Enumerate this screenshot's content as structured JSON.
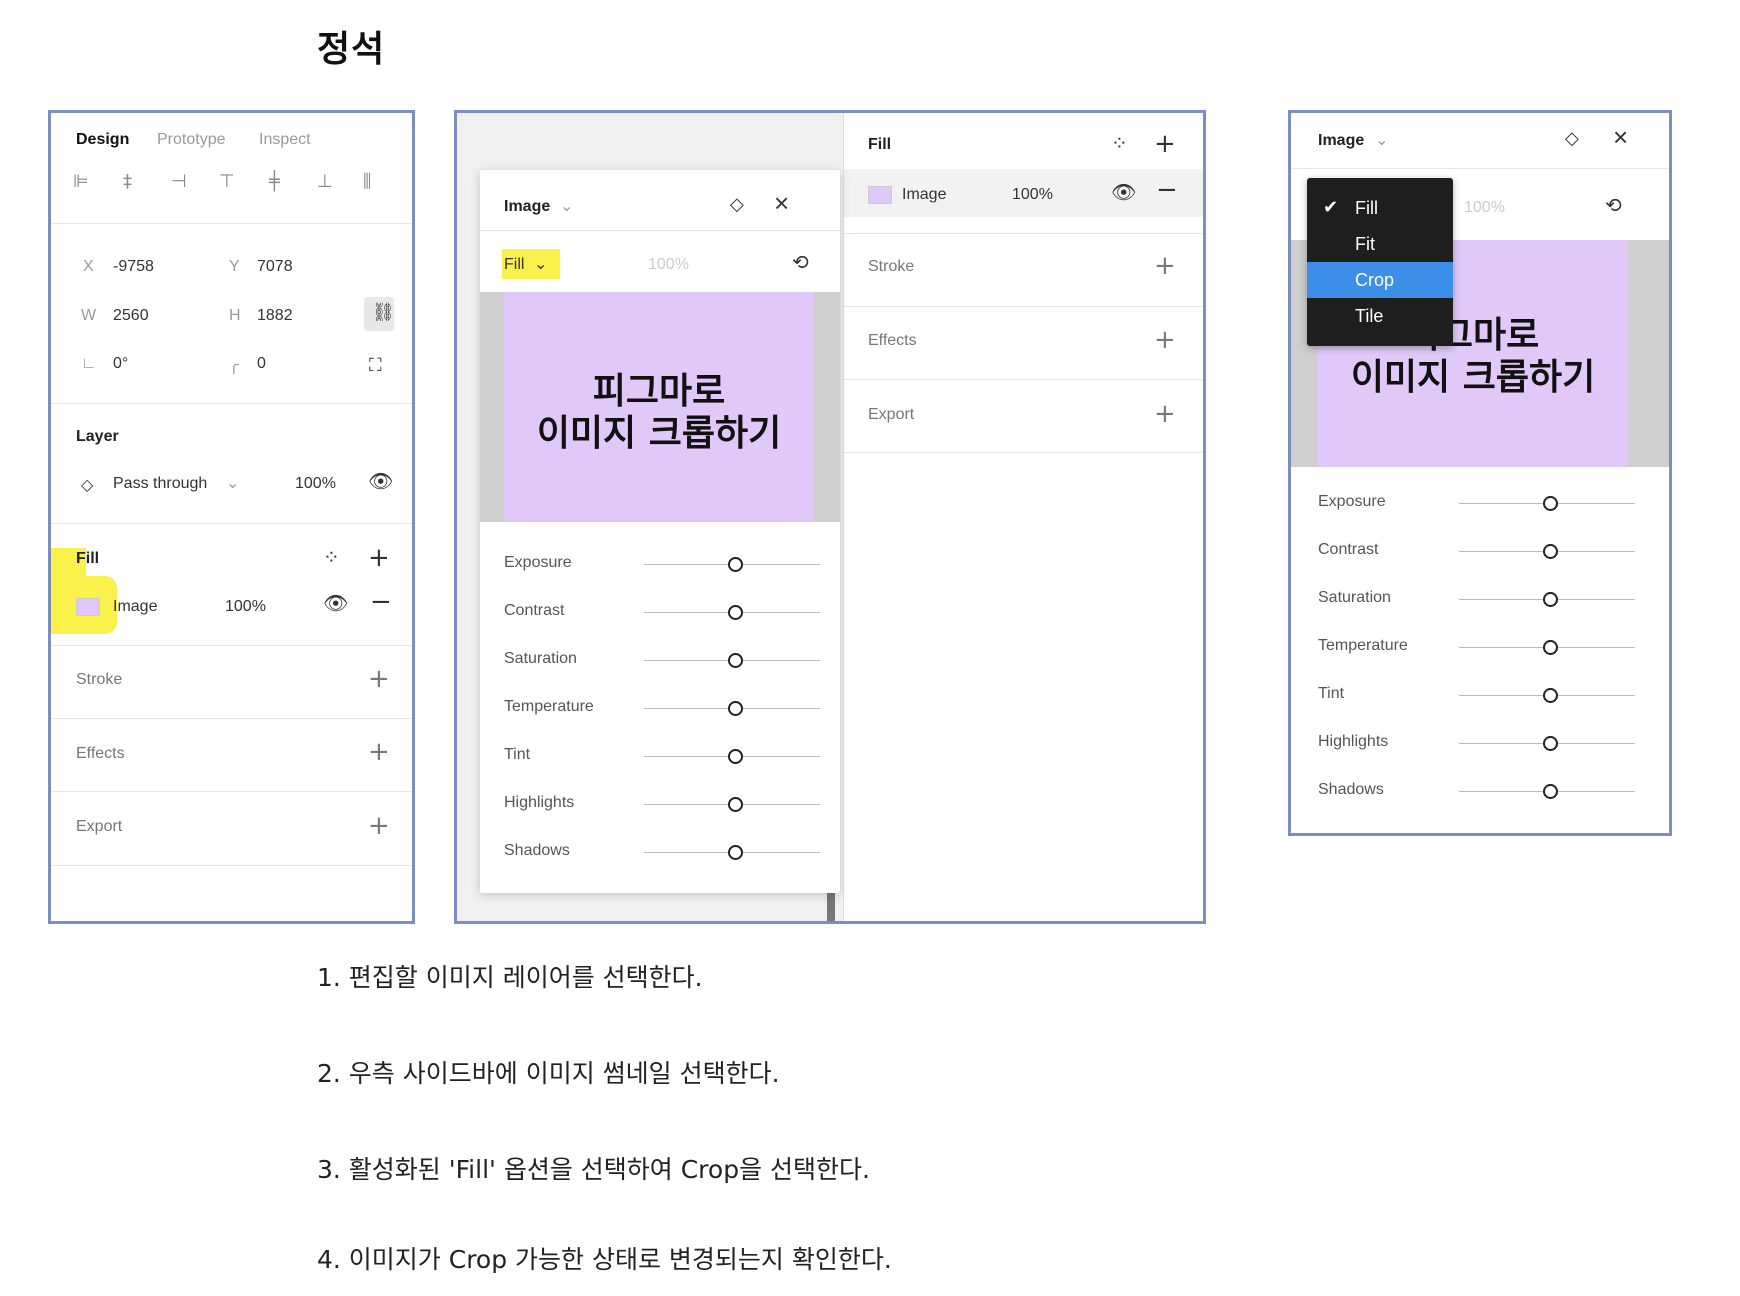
{
  "heading": "정석",
  "left_panel": {
    "tabs": [
      "Design",
      "Prototype",
      "Inspect"
    ],
    "x_label": "X",
    "x_value": "-9758",
    "y_label": "Y",
    "y_value": "7078",
    "w_label": "W",
    "w_value": "2560",
    "h_label": "H",
    "h_value": "1882",
    "rotation": "0°",
    "radius": "0",
    "layer_title": "Layer",
    "blend_mode": "Pass through",
    "layer_opacity": "100%",
    "fill_title": "Fill",
    "fill_type": "Image",
    "fill_opacity": "100%",
    "stroke": "Stroke",
    "effects": "Effects",
    "export": "Export"
  },
  "middle_panel": {
    "popup_title": "Image",
    "fill_mode": "Fill",
    "fill_opacity": "100%",
    "preview_line1": "피그마로",
    "preview_line2": "이미지 크롭하기",
    "adjustments": [
      "Exposure",
      "Contrast",
      "Saturation",
      "Temperature",
      "Tint",
      "Highlights",
      "Shadows"
    ],
    "right_fill_title": "Fill",
    "right_fill_type": "Image",
    "right_fill_opacity": "100%",
    "stroke": "Stroke",
    "effects": "Effects",
    "export": "Export"
  },
  "right_panel": {
    "popup_title": "Image",
    "fill_opacity": "100%",
    "menu_items": [
      "Fill",
      "Fit",
      "Crop",
      "Tile"
    ],
    "selected_menu": "Fill",
    "highlighted_menu": "Crop",
    "preview_line1": "피그마로",
    "preview_line2": "이미지 크롭하기",
    "adjustments": [
      "Exposure",
      "Contrast",
      "Saturation",
      "Temperature",
      "Tint",
      "Highlights",
      "Shadows"
    ]
  },
  "steps": [
    "1. 편집할 이미지 레이어를 선택한다.",
    "2. 우측 사이드바에 이미지 썸네일 선택한다.",
    "3. 활성화된 'Fill' 옵션을 선택하여 Crop을 선택한다.",
    "4. 이미지가 Crop 가능한 상태로 변경되는지 확인한다."
  ],
  "colors": {
    "frame_border": "#7d8fc0",
    "highlight": "#fbf14b",
    "preview_bg": "#e0c8f8",
    "menu_bg": "#1e1e1e",
    "menu_selected": "#3d8ee8"
  }
}
